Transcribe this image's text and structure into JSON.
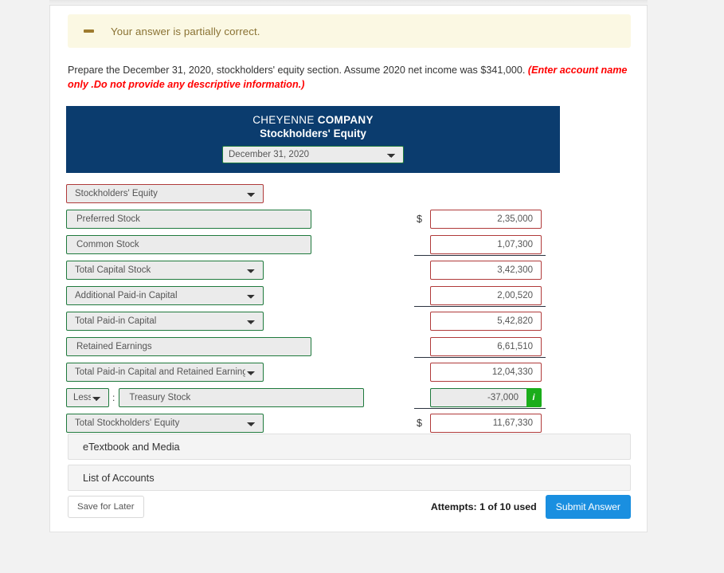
{
  "alert": {
    "icon": "minus-icon",
    "message": "Your answer is partially correct."
  },
  "instructions": {
    "main": "Prepare the December 31, 2020, stockholders' equity section. Assume 2020 net income was $341,000.",
    "hint": "(Enter account name only .Do not provide any descriptive information.)"
  },
  "statement": {
    "company_prefix": "CHEYENNE",
    "company_suffix": "COMPANY",
    "subtitle": "Stockholders' Equity",
    "date_value": "December 31, 2020"
  },
  "rows": [
    {
      "label": "Stockholders' Equity",
      "control": "select",
      "label_border": "red",
      "amount": null
    },
    {
      "label": "Preferred Stock",
      "control": "text",
      "label_border": "green",
      "amount": "2,35,000",
      "dollar": "$"
    },
    {
      "label": "Common Stock",
      "control": "text",
      "label_border": "green",
      "amount": "1,07,300",
      "dollar": ""
    },
    {
      "label": "Total Capital Stock",
      "control": "select",
      "label_border": "green",
      "amount": "3,42,300",
      "dollar": ""
    },
    {
      "label": "Additional Paid-in Capital",
      "control": "select",
      "label_border": "green",
      "amount": "2,00,520",
      "dollar": ""
    },
    {
      "label": "Total Paid-in Capital",
      "control": "select",
      "label_border": "green",
      "amount": "5,42,820",
      "dollar": ""
    },
    {
      "label": "Retained Earnings",
      "control": "text",
      "label_border": "green",
      "amount": "6,61,510",
      "dollar": ""
    },
    {
      "label": "Total Paid-in Capital and Retained Earnings",
      "control": "select",
      "label_border": "green",
      "amount": "12,04,330",
      "dollar": ""
    },
    {
      "label": "Treasury Stock",
      "control": "less-text",
      "operator": "Less",
      "separator": ":",
      "label_border": "green",
      "amount": "-37,000",
      "dollar": "",
      "badge": "i"
    },
    {
      "label": "Total Stockholders' Equity",
      "control": "select",
      "label_border": "green",
      "amount": "11,67,330",
      "dollar": "$"
    }
  ],
  "bars": [
    {
      "label": "eTextbook and Media"
    },
    {
      "label": "List of Accounts"
    }
  ],
  "footer": {
    "save_label": "Save for Later",
    "attempts": "Attempts: 1 of 10 used",
    "submit_label": "Submit Answer"
  },
  "colors": {
    "header_blue": "#0b3c6e",
    "alert_bg": "#fbf8e3",
    "alert_text": "#8a7233",
    "valid_green": "#1f7a3d",
    "invalid_red": "#b03a3a",
    "hint_red": "#ff0000",
    "submit_blue": "#1a8fe0",
    "badge_green": "#1aad1a"
  }
}
